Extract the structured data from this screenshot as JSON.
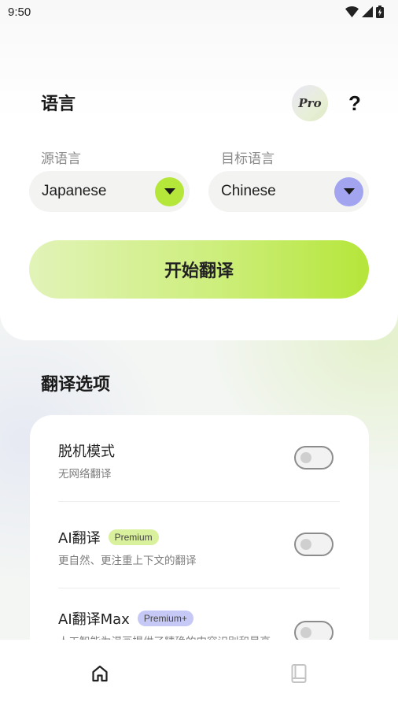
{
  "status_bar": {
    "time": "9:50"
  },
  "header": {
    "title": "语言",
    "pro_label": "Pro",
    "help_label": "?"
  },
  "source": {
    "label": "源语言",
    "value": "Japanese",
    "accent": "#b5e63a"
  },
  "target": {
    "label": "目标语言",
    "value": "Chinese",
    "accent": "#a3a4f0"
  },
  "start_button": {
    "label": "开始翻译"
  },
  "options": {
    "title": "翻译选项",
    "items": [
      {
        "title": "脱机模式",
        "desc": "无网络翻译",
        "tag": "",
        "enabled": false
      },
      {
        "title": "AI翻译",
        "desc": "更自然、更注重上下文的翻译",
        "tag": "Premium",
        "tag_color": "#d9f09c",
        "enabled": false
      },
      {
        "title": "AI翻译Max",
        "desc": "人工智能为漫画提供了精确的内容识别和最高",
        "tag": "Premium+",
        "tag_color": "#c6c8f5",
        "enabled": false
      }
    ]
  },
  "bottom_nav": {
    "items": [
      {
        "icon": "home-icon",
        "active": true
      },
      {
        "icon": "book-icon",
        "active": false
      }
    ]
  }
}
